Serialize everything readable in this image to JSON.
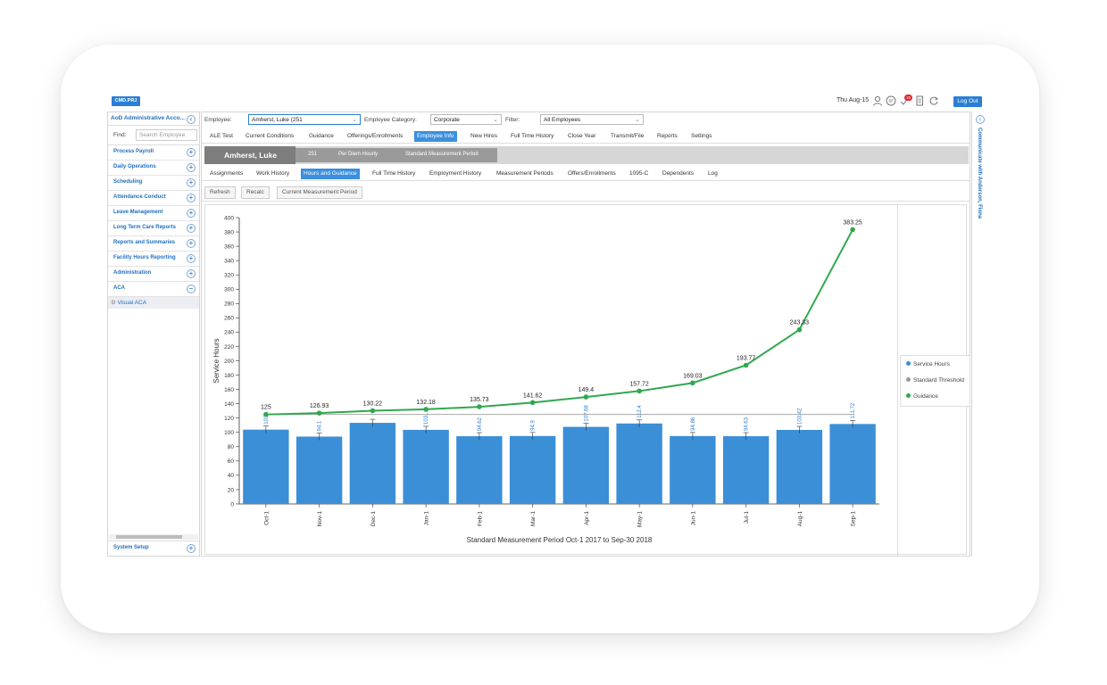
{
  "topbar": {
    "logo": "CMD.PRJ",
    "date": "Thu Aug-15",
    "notification_count": "10",
    "logout": "Log Out"
  },
  "sidebar": {
    "account": "AoD Administrative Acco...",
    "find_label": "Find:",
    "find_placeholder": "Search Employee",
    "items": [
      {
        "label": "Process Payroll"
      },
      {
        "label": "Daily Operations"
      },
      {
        "label": "Scheduling"
      },
      {
        "label": "Attendance Conduct"
      },
      {
        "label": "Leave Management"
      },
      {
        "label": "Long Term Care Reports"
      },
      {
        "label": "Reports and Summaries"
      },
      {
        "label": "Facility Hours Reporting"
      },
      {
        "label": "Administration"
      },
      {
        "label": "ACA"
      }
    ],
    "sub_item": "Visual ACA",
    "footer": "System Setup"
  },
  "rightbar": {
    "text": "Communicate with Anderson, Fiona"
  },
  "filters": {
    "employee_label": "Employee:",
    "employee_value": "Amherst, Luke  (251",
    "category_label": "Employee Category:",
    "category_value": "Corporate",
    "filter_label": "Filter:",
    "filter_value": "All Employees"
  },
  "tabs": [
    "ALE Test",
    "Current Conditions",
    "Guidance",
    "Offerings/Enrollments",
    "Employee Info",
    "New Hires",
    "Full Time History",
    "Close Year",
    "Transmit/File",
    "Reports",
    "Settings"
  ],
  "employee": {
    "name": "Amherst, Luke",
    "id": "251",
    "type": "Per Diem Hourly",
    "period": "Standard Measurement Period"
  },
  "subtabs": [
    "Assignments",
    "Work History",
    "Hours and Guidance",
    "Full Time History",
    "Employment History",
    "Measurement Periods",
    "Offers/Enrollments",
    "1095-C",
    "Dependents",
    "Log"
  ],
  "actions": [
    "Refresh",
    "Recalc",
    "Current Measurement Period"
  ],
  "legend": [
    "Service Hours",
    "Standard Threshold",
    "Guidance"
  ],
  "colors": {
    "bar": "#3b8fd6",
    "guidance": "#2fa84f",
    "threshold": "#9a9a9a",
    "accent": "#2a7fd4"
  },
  "chart_data": {
    "type": "bar",
    "xlabel": "Standard Measurement Period Oct-1 2017 to Sep-30 2018",
    "ylabel": "Service Hours",
    "ylim": [
      0,
      400
    ],
    "yticks": [
      0,
      20,
      40,
      60,
      80,
      100,
      120,
      140,
      160,
      180,
      200,
      220,
      240,
      260,
      280,
      300,
      320,
      340,
      360,
      380,
      400
    ],
    "categories": [
      "Oct-1",
      "Nov-1",
      "Dec-1",
      "Jan-1",
      "Feb-1",
      "Mar-1",
      "Apr-1",
      "May-1",
      "Jun-1",
      "Jul-1",
      "Aug-1",
      "Sep-1"
    ],
    "threshold": 125,
    "series": [
      {
        "name": "Service Hours",
        "values": [
          103.81,
          94.1,
          113.3,
          103.5,
          94.62,
          94.9,
          107.68,
          112.4,
          94.86,
          94.63,
          103.42,
          111.72
        ],
        "labels": [
          "103...",
          "94.1",
          "",
          "103...",
          "94.62",
          "94.9",
          "107.68",
          "112.4",
          "94.86",
          "94.63",
          "103.42",
          "111.72"
        ]
      },
      {
        "name": "Guidance",
        "values": [
          125,
          126.93,
          130.22,
          132.18,
          135.73,
          141.62,
          149.4,
          157.72,
          169.03,
          193.77,
          243.33,
          383.25
        ],
        "labels": [
          "125",
          "126.93",
          "130.22",
          "132.18",
          "135.73",
          "141.62",
          "149.4",
          "157.72",
          "169.03",
          "193.77",
          "243.33",
          "383.25"
        ]
      }
    ]
  }
}
